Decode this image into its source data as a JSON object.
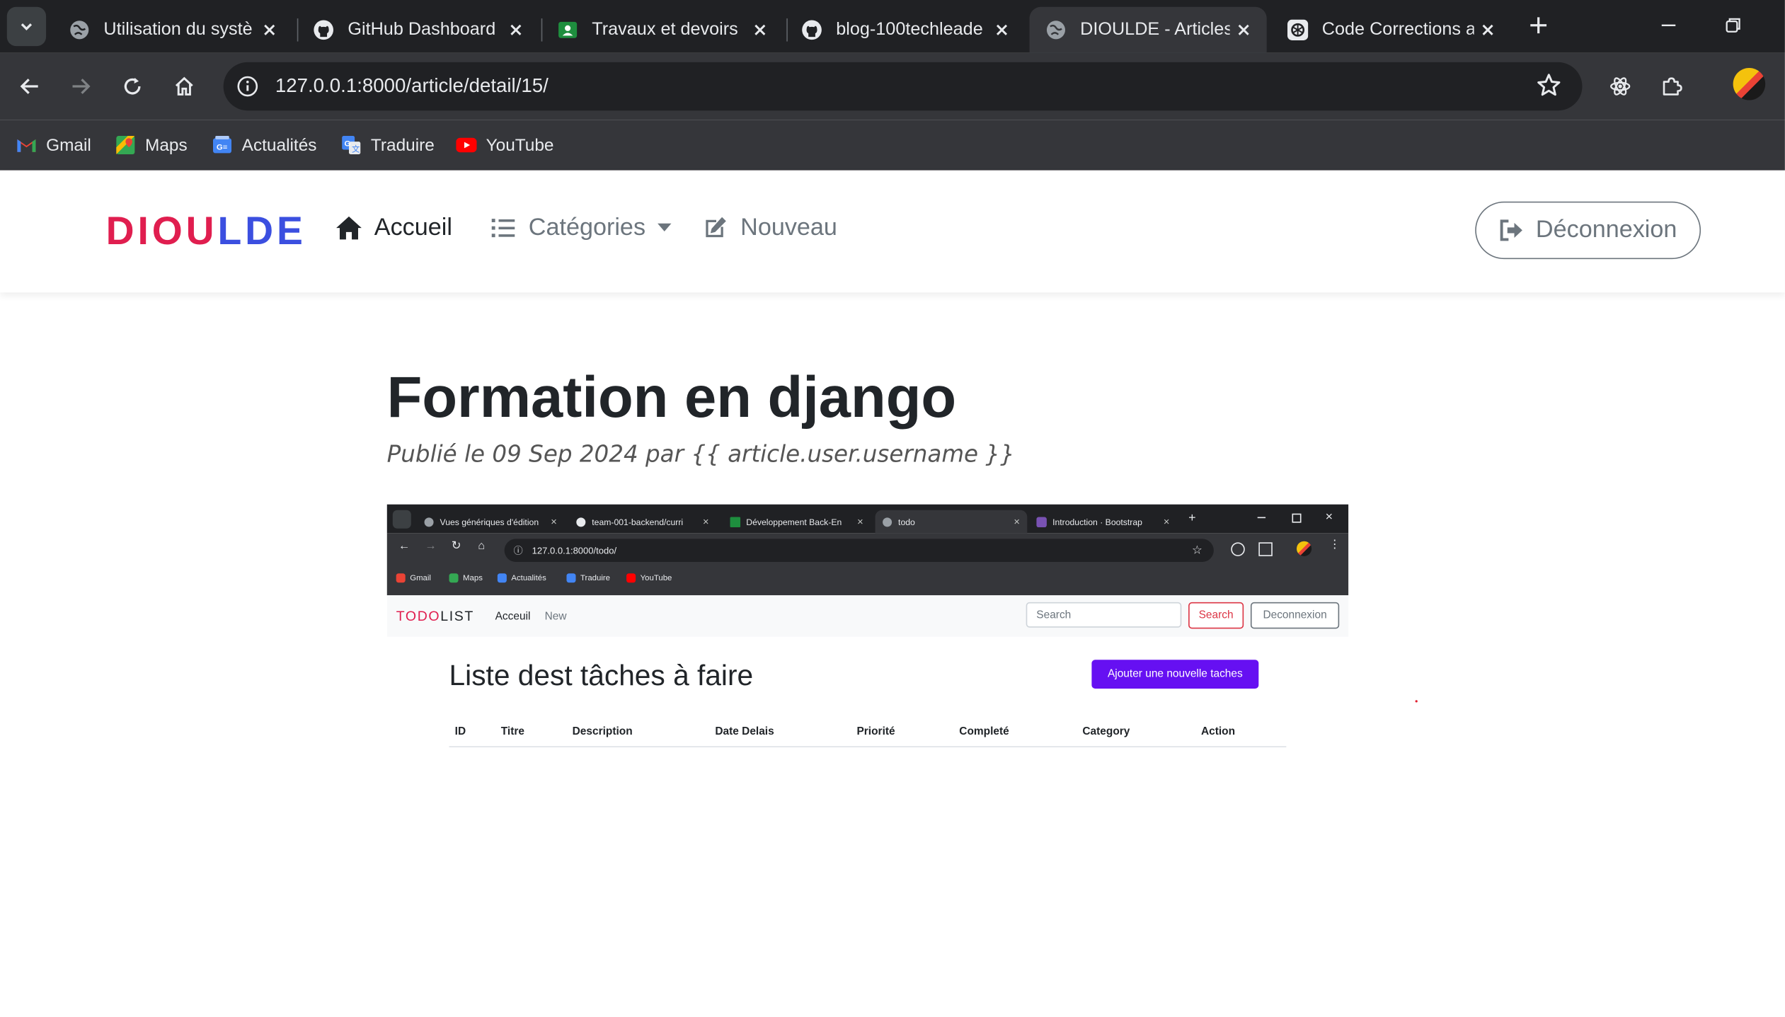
{
  "browser": {
    "tabs": [
      {
        "title": "Utilisation du systè",
        "icon": "globe-icon",
        "active": false
      },
      {
        "title": "GitHub Dashboard",
        "icon": "github-icon",
        "active": false
      },
      {
        "title": "Travaux et devoirs",
        "icon": "classroom-icon",
        "active": false
      },
      {
        "title": "blog-100techleade",
        "icon": "github-icon",
        "active": false
      },
      {
        "title": "DIOULDE - Articles",
        "icon": "globe-icon",
        "active": true
      },
      {
        "title": "Code Corrections a",
        "icon": "chatgpt-icon",
        "active": false
      }
    ],
    "url": "127.0.0.1:8000/article/detail/15/",
    "bookmarks": [
      {
        "label": "Gmail",
        "icon": "gmail-icon"
      },
      {
        "label": "Maps",
        "icon": "maps-icon"
      },
      {
        "label": "Actualités",
        "icon": "news-icon"
      },
      {
        "label": "Traduire",
        "icon": "translate-icon"
      },
      {
        "label": "YouTube",
        "icon": "youtube-icon"
      }
    ]
  },
  "site": {
    "brand_part1": "DIOU",
    "brand_part2": "LDE",
    "nav": {
      "home": "Accueil",
      "categories": "Catégories",
      "new": "Nouveau",
      "logout": "Déconnexion"
    }
  },
  "article": {
    "title": "Formation en django",
    "meta": "Publié le 09 Sep 2024 par {{ article.user.username }}"
  },
  "screenshot": {
    "tabs": [
      {
        "title": "Vues génériques d'édition",
        "active": false
      },
      {
        "title": "team-001-backend/curri",
        "active": false
      },
      {
        "title": "Développement Back-En",
        "active": false
      },
      {
        "title": "todo",
        "active": true
      },
      {
        "title": "Introduction · Bootstrap",
        "active": false
      }
    ],
    "url": "127.0.0.1:8000/todo/",
    "bookmarks": [
      "Gmail",
      "Maps",
      "Actualités",
      "Traduire",
      "YouTube"
    ],
    "brand_part1": "TODO",
    "brand_part2": "LIST",
    "nav_home": "Acceuil",
    "nav_new": "New",
    "search_placeholder": "Search",
    "search_button": "Search",
    "logout_button": "Deconnexion",
    "heading": "Liste dest tâches à faire",
    "add_button": "Ajouter une nouvelle taches",
    "table_headers": [
      "ID",
      "Titre",
      "Description",
      "Date Delais",
      "Priorité",
      "Completé",
      "Category",
      "Action"
    ]
  },
  "colors": {
    "brand_red": "#e01e4f",
    "brand_blue": "#3b4fe0",
    "add_button_purple": "#6610f2"
  }
}
